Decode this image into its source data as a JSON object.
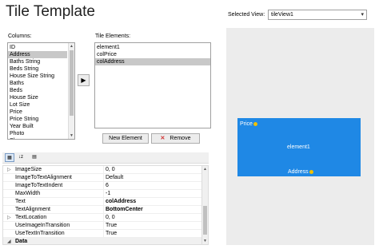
{
  "title": "Tile Template",
  "selected_view": {
    "label": "Selected View:",
    "value": "tileView1"
  },
  "columns": {
    "label": "Columns:",
    "items": [
      "ID",
      "Address",
      "Baths String",
      "Beds String",
      "House Size String",
      "Baths",
      "Beds",
      "House Size",
      "Lot Size",
      "Price",
      "Price String",
      "Year Built",
      "Photo",
      "Sl..."
    ],
    "selected_index": 1
  },
  "tile_elements": {
    "label": "Tile Elements:",
    "items": [
      "element1",
      "colPrice",
      "colAddress"
    ],
    "selected_index": 2
  },
  "buttons": {
    "move": "▶",
    "new_element": "New Element",
    "remove": "Remove",
    "remove_icon": "✕"
  },
  "preview": {
    "tile_color": "#1f88e5",
    "price_label": "Price",
    "center_label": "element1",
    "address_label": "Address"
  },
  "toolbar": {
    "categorized_icon": "categorized-icon",
    "alphabetical_icon": "sort-alpha-icon",
    "pages_icon": "property-pages-icon"
  },
  "properties": [
    {
      "expander": "▷",
      "name": "ImageSize",
      "value": "0, 0",
      "bold": false
    },
    {
      "expander": "",
      "name": "ImageToTextAlignment",
      "value": "Default",
      "bold": false
    },
    {
      "expander": "",
      "name": "ImageToTextIndent",
      "value": "6",
      "bold": false
    },
    {
      "expander": "",
      "name": "MaxWidth",
      "value": "-1",
      "bold": false
    },
    {
      "expander": "",
      "name": "Text",
      "value": "colAddress",
      "bold": true
    },
    {
      "expander": "",
      "name": "TextAlignment",
      "value": "BottomCenter",
      "bold": true
    },
    {
      "expander": "▷",
      "name": "TextLocation",
      "value": "0, 0",
      "bold": false
    },
    {
      "expander": "",
      "name": "UseImageInTransition",
      "value": "True",
      "bold": false
    },
    {
      "expander": "",
      "name": "UseTextInTransition",
      "value": "True",
      "bold": false
    },
    {
      "expander": "◢",
      "name": "Data",
      "value": "",
      "bold": false,
      "section": true
    }
  ]
}
